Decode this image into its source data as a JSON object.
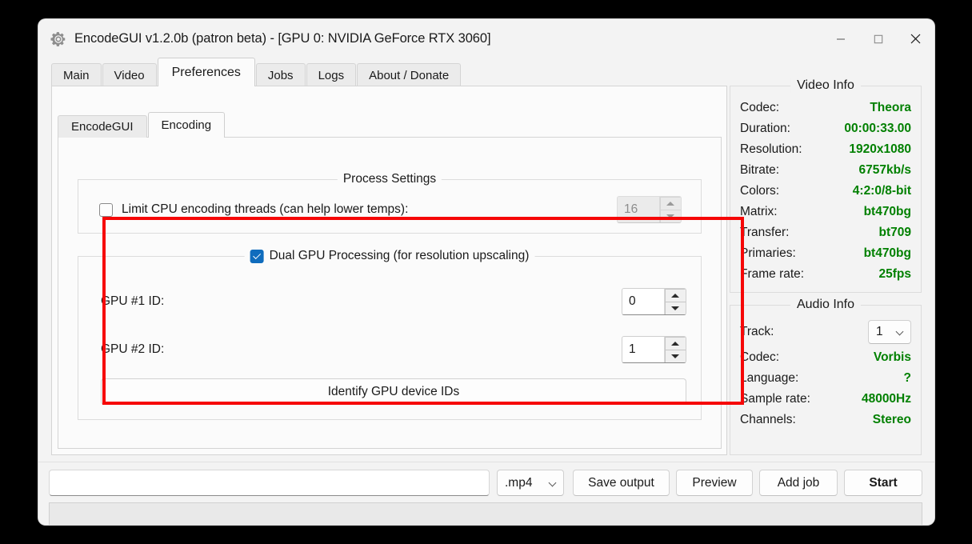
{
  "window": {
    "icon": "gear-icon",
    "title": "EncodeGUI v1.2.0b (patron beta) - [GPU 0: NVIDIA GeForce RTX 3060]",
    "controls": {
      "minimize": "minimize-icon",
      "maximize": "maximize-icon",
      "close": "close-icon"
    }
  },
  "tabs": [
    {
      "label": "Main",
      "active": false
    },
    {
      "label": "Video",
      "active": false
    },
    {
      "label": "Preferences",
      "active": true
    },
    {
      "label": "Jobs",
      "active": false
    },
    {
      "label": "Logs",
      "active": false
    },
    {
      "label": "About / Donate",
      "active": false
    }
  ],
  "subtabs": [
    {
      "label": "EncodeGUI",
      "active": false
    },
    {
      "label": "Encoding",
      "active": true
    }
  ],
  "process_settings": {
    "legend": "Process Settings",
    "limit_threads": {
      "label": "Limit CPU encoding threads (can help lower temps):",
      "checked": false,
      "value": "16",
      "enabled": false
    }
  },
  "dual_gpu": {
    "legend": "Dual GPU Processing (for resolution upscaling)",
    "checked": true,
    "highlight_color": "#f60707",
    "gpu1": {
      "label": "GPU #1 ID:",
      "value": "0"
    },
    "gpu2": {
      "label": "GPU #2 ID:",
      "value": "1"
    },
    "identify_button": "Identify GPU device IDs"
  },
  "video_info": {
    "legend": "Video Info",
    "accent_color": "#008000",
    "rows": [
      {
        "key": "Codec:",
        "value": "Theora"
      },
      {
        "key": "Duration:",
        "value": "00:00:33.00"
      },
      {
        "key": "Resolution:",
        "value": "1920x1080"
      },
      {
        "key": "Bitrate:",
        "value": "6757kb/s"
      },
      {
        "key": "Colors:",
        "value": "4:2:0/8-bit"
      },
      {
        "key": "Matrix:",
        "value": "bt470bg"
      },
      {
        "key": "Transfer:",
        "value": "bt709"
      },
      {
        "key": "Primaries:",
        "value": "bt470bg"
      },
      {
        "key": "Frame rate:",
        "value": "25fps"
      }
    ]
  },
  "audio_info": {
    "legend": "Audio Info",
    "accent_color": "#008000",
    "track": {
      "key": "Track:",
      "value": "1"
    },
    "rows": [
      {
        "key": "Codec:",
        "value": "Vorbis"
      },
      {
        "key": "Language:",
        "value": "?"
      },
      {
        "key": "Sample rate:",
        "value": "48000Hz"
      },
      {
        "key": "Channels:",
        "value": "Stereo"
      }
    ]
  },
  "bottom_bar": {
    "output_path": {
      "value": "",
      "placeholder": ""
    },
    "format": ".mp4",
    "save_output": "Save output",
    "preview": "Preview",
    "add_job": "Add job",
    "start": "Start",
    "status": ""
  }
}
